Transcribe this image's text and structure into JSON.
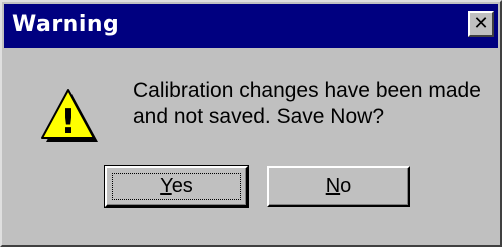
{
  "window": {
    "title": "Warning",
    "close_glyph": "✕"
  },
  "icon": {
    "name": "warning-icon",
    "glyph": "!",
    "color": "#ffff00"
  },
  "message": {
    "line1": "Calibration changes have been made",
    "line2": "and not saved. Save Now?"
  },
  "buttons": {
    "yes": {
      "accel": "Y",
      "rest": "es"
    },
    "no": {
      "accel": "N",
      "rest": "o"
    }
  }
}
